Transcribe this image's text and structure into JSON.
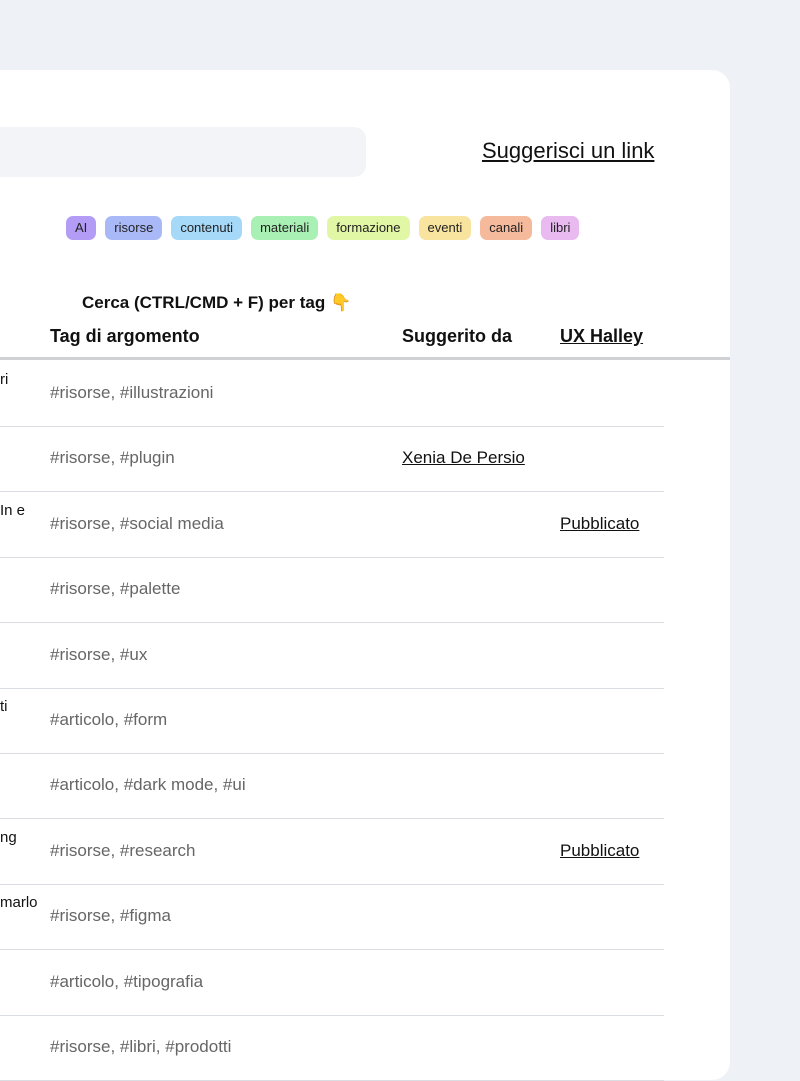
{
  "suggest_link": "Suggerisci un link",
  "search": {
    "placeholder": ""
  },
  "tags": [
    {
      "label": "AI",
      "color": "#b39cf5"
    },
    {
      "label": "risorse",
      "color": "#a9b9f7"
    },
    {
      "label": "contenuti",
      "color": "#a6d8f7"
    },
    {
      "label": "materiali",
      "color": "#a8f0b3"
    },
    {
      "label": "formazione",
      "color": "#e2f7a6"
    },
    {
      "label": "eventi",
      "color": "#f8e49f"
    },
    {
      "label": "canali",
      "color": "#f5b99b"
    },
    {
      "label": "libri",
      "color": "#e8baf0"
    }
  ],
  "hint": "Cerca (CTRL/CMD + F) per tag",
  "hint_emoji": "👇",
  "columns": {
    "topic": "Tag di argomento",
    "suggested_by": "Suggerito da",
    "ux_halley": "UX Halley"
  },
  "rows": [
    {
      "cut": "ri",
      "tags": "#risorse, #illustrazioni",
      "suggested": "",
      "ux": ""
    },
    {
      "cut": "",
      "tags": "#risorse, #plugin",
      "suggested": "Xenia De Persio",
      "ux": ""
    },
    {
      "cut": "In e",
      "tags": "#risorse, #social media",
      "suggested": "",
      "ux": "Pubblicato"
    },
    {
      "cut": "",
      "tags": "#risorse, #palette",
      "suggested": "",
      "ux": ""
    },
    {
      "cut": "",
      "tags": "#risorse, #ux",
      "suggested": "",
      "ux": ""
    },
    {
      "cut": "ti",
      "tags": "#articolo, #form",
      "suggested": "",
      "ux": ""
    },
    {
      "cut": "",
      "tags": "#articolo, #dark mode, #ui",
      "suggested": "",
      "ux": ""
    },
    {
      "cut": "ng",
      "tags": "#risorse, #research",
      "suggested": "",
      "ux": "Pubblicato"
    },
    {
      "cut": "marlo",
      "tags": "#risorse, #figma",
      "suggested": "",
      "ux": ""
    },
    {
      "cut": "",
      "tags": "#articolo, #tipografia",
      "suggested": "",
      "ux": ""
    },
    {
      "cut": "",
      "tags": "#risorse, #libri, #prodotti",
      "suggested": "",
      "ux": ""
    }
  ]
}
